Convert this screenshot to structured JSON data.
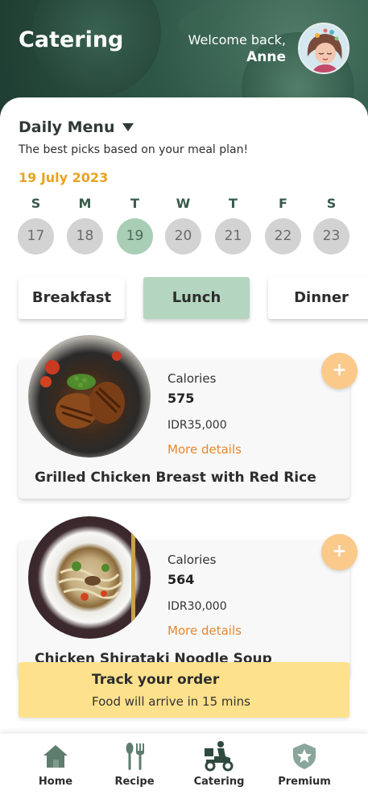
{
  "header": {
    "title": "Catering",
    "welcome_line": "Welcome back,",
    "user_name": "Anne"
  },
  "menu": {
    "heading": "Daily Menu",
    "subtitle": "The best picks based on your meal plan!",
    "date": "19 July 2023"
  },
  "days": [
    {
      "letter": "S",
      "num": "17"
    },
    {
      "letter": "M",
      "num": "18"
    },
    {
      "letter": "T",
      "num": "19"
    },
    {
      "letter": "W",
      "num": "20"
    },
    {
      "letter": "T",
      "num": "21"
    },
    {
      "letter": "F",
      "num": "22"
    },
    {
      "letter": "S",
      "num": "23"
    }
  ],
  "selected_day": "19",
  "meal_tabs": {
    "breakfast": "Breakfast",
    "lunch": "Lunch",
    "dinner": "Dinner",
    "selected": "Lunch"
  },
  "items": [
    {
      "calories_label": "Calories",
      "calories": "575",
      "price": "IDR35,000",
      "more": "More details",
      "name": "Grilled Chicken Breast with Red Rice",
      "add": "+"
    },
    {
      "calories_label": "Calories",
      "calories": "564",
      "price": "IDR30,000",
      "more": "More details",
      "name": "Chicken Shirataki Noodle Soup",
      "add": "+"
    }
  ],
  "track": {
    "title": "Track your order",
    "subtitle": "Food will arrive in 15 mins"
  },
  "nav": {
    "home": "Home",
    "recipe": "Recipe",
    "catering": "Catering",
    "premium": "Premium",
    "active": "Catering"
  },
  "colors": {
    "header_green": "#2f5848",
    "accent_orange": "#e8a321",
    "link_orange": "#e8862b",
    "selected_green": "#b4d6c0",
    "track_yellow": "#fde18c",
    "plus_orange": "#fbc98a"
  },
  "icons": {
    "home": "home-icon",
    "recipe": "fork-spoon-icon",
    "catering": "delivery-scooter-icon",
    "premium": "badge-star-icon",
    "daily_menu_caret": "caret-down-icon",
    "add": "plus-icon"
  }
}
